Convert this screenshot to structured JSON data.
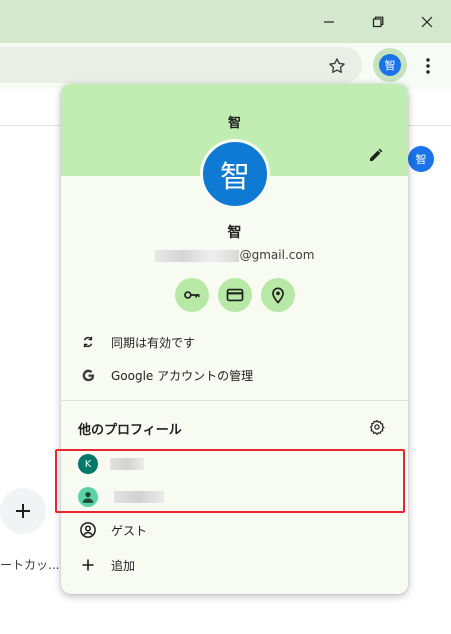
{
  "window": {
    "minimize_icon": "minimize-icon",
    "restore_icon": "restore-icon",
    "close_icon": "close-icon"
  },
  "toolbar": {
    "avatar_char": "智"
  },
  "page": {
    "right_avatar_char": "智",
    "shortcut_label": "ートカッ..."
  },
  "panel": {
    "header_name": "智",
    "avatar_char": "智",
    "profile_name": "智",
    "email_suffix": "@gmail.com",
    "sync_label": "同期は有効です",
    "google_account_label": "Google アカウントの管理",
    "other_profiles_title": "他のプロフィール",
    "profiles": [
      {
        "initial": "K",
        "color": "#00796b"
      },
      {
        "initial": "",
        "color": "#5ad3a8"
      }
    ],
    "guest_label": "ゲスト",
    "add_label": "追加",
    "highlight_color": "#e8262d"
  }
}
